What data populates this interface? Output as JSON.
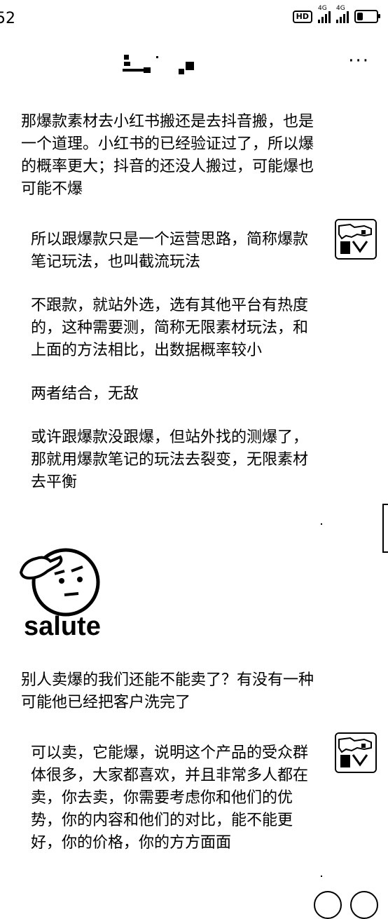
{
  "status_bar": {
    "time": "52",
    "hd_badge": "HD",
    "signal1_label": "4G",
    "signal2_label": "4G"
  },
  "header": {
    "more_label": "···"
  },
  "messages": {
    "m1": "那爆款素材去小红书搬还是去抖音搬，也是一个道理。小红书的已经验证过了，所以爆的概率更大；抖音的还没人搬过，可能爆也可能不爆",
    "m2_p1": "所以跟爆款只是一个运营思路，简称爆款笔记玩法，也叫截流玩法",
    "m2_p2": "不跟款，就站外选，选有其他平台有热度的，这种需要测，简称无限素材玩法，和上面的方法相比，出数据概率较小",
    "m2_p3": "两者结合，无敌",
    "m2_p4": "或许跟爆款没跟爆，但站外找的测爆了，那就用爆款笔记的玩法去裂变，无限素材去平衡",
    "sticker_label": "salute",
    "m3": "别人卖爆的我们还能不能卖了？有没有一种可能他已经把客户洗完了",
    "m4": "可以卖，它能爆，说明这个产品的受众群体很多，大家都喜欢，并且非常多人都在卖，你去卖，你需要考虑你和他们的优势，你的内容和他们的对比，能不能更好，你的价格，你的方方面面"
  }
}
